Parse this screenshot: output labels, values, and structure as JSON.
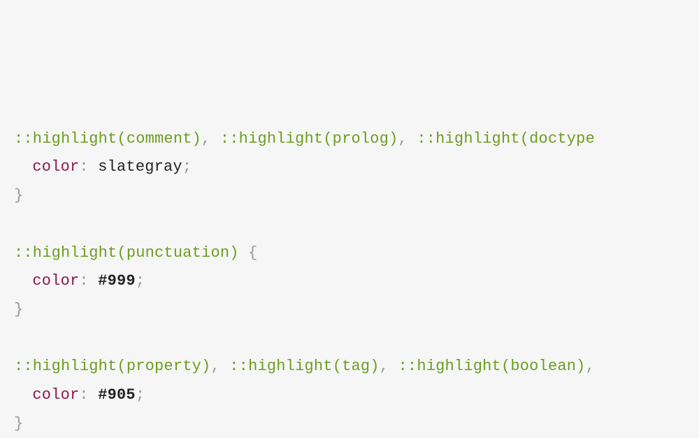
{
  "r1_s1": "::highlight(comment)",
  "r1_c1": ", ",
  "r1_s2": "::highlight(prolog)",
  "r1_c2": ", ",
  "r1_s3": "::highlight(doctype",
  "r1_prop": "color",
  "r1_colon": ": ",
  "r1_value": "slategray",
  "r1_semi": ";",
  "r1_close": "}",
  "r2_s1": "::highlight(punctuation)",
  "r2_sp": " ",
  "r2_brace": "{",
  "r2_prop": "color",
  "r2_colon": ": ",
  "r2_value": "#999",
  "r2_semi": ";",
  "r2_close": "}",
  "r3_s1": "::highlight(property)",
  "r3_c1": ", ",
  "r3_s2": "::highlight(tag)",
  "r3_c2": ", ",
  "r3_s3": "::highlight(boolean)",
  "r3_c3": ",",
  "r3_prop": "color",
  "r3_colon": ": ",
  "r3_value": "#905",
  "r3_semi": ";",
  "r3_close": "}"
}
